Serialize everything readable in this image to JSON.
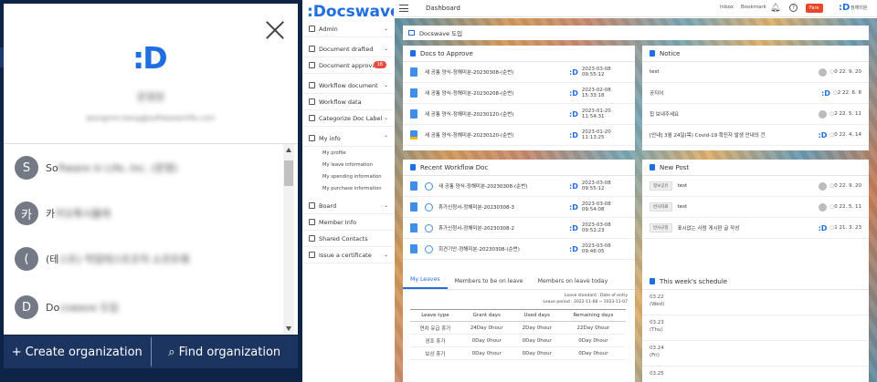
{
  "org_popup": {
    "logo": ":D",
    "user_name": "운영원",
    "user_email": "jeongmin.kang@softwareinlife.com",
    "orgs": [
      {
        "avatar": "S",
        "name": "So",
        "name_blur": "ftware in Life, Inc. (운영)"
      },
      {
        "avatar": "카",
        "name": "카",
        "name_blur": "카오톡시뮬레"
      },
      {
        "avatar": "(",
        "name": "(테",
        "name_blur": "스트) 작업테스트조직 소프트웨"
      },
      {
        "avatar": "D",
        "name": "Do",
        "name_blur": "cswave 도입"
      }
    ],
    "create_label": "Create organization",
    "find_label": "Find organization",
    "create_icon": "+",
    "find_icon": "⌕"
  },
  "brand": ":Docswave",
  "sidebar": {
    "items": [
      {
        "label": "Admin",
        "chev": "⌄"
      },
      {
        "label": "Document drafted",
        "chev": "⌄"
      },
      {
        "label": "Document approval",
        "badge": "18"
      },
      {
        "label": "Workflow document",
        "chev": "⌄"
      },
      {
        "label": "Workflow data"
      },
      {
        "label": "Categorize Doc Label",
        "chev": "⌄"
      },
      {
        "label": "My info",
        "chev": "⌃"
      }
    ],
    "sub": [
      "My profile",
      "My leave information",
      "My spending information",
      "My purchase information"
    ],
    "items2": [
      {
        "label": "Board",
        "chev": "⌄"
      },
      {
        "label": "Member Info"
      },
      {
        "label": "Shared Contacts"
      },
      {
        "label": "Issue a certificate",
        "chev": "⌄"
      }
    ]
  },
  "topbar": {
    "title": "Dashboard",
    "inbox": "Inbox",
    "bookmark": "Bookmark",
    "fare": "Fare",
    "user": "정해미분",
    "mini_logo": ":D"
  },
  "breadcrumb": "Docswave 도입",
  "docs_to_approve": {
    "title": "Docs to Approve",
    "rows": [
      {
        "title": "새 공통 양식-정해미분-20230308-(순번)",
        "date": "2023-03-08 09:55:12"
      },
      {
        "title": "새 공통 양식-정해미분-20230208-(순번)",
        "date": "2023-02-08 15:33:18"
      },
      {
        "title": "새 공통 양식-정해미분-20230120-(순번)",
        "date": "2023-01-20 11:54:31"
      },
      {
        "title": "새 공통 양식-정해미분-20230120-(순번)",
        "date": "2023-01-20 11:13:25"
      }
    ]
  },
  "notice": {
    "title": "Notice",
    "rows": [
      {
        "title": "test",
        "count": "0",
        "date": "22. 9. 20"
      },
      {
        "title": "공지어",
        "count": "2",
        "date": "22. 6. 8"
      },
      {
        "title": "칩 보내주세요",
        "count": "2",
        "date": "22. 5. 11"
      },
      {
        "title": "[안내] 3월 24일(목) Covid-19 확진자 발생 안내의 건",
        "count": "0",
        "date": "22. 4. 14"
      }
    ]
  },
  "recent_workflow": {
    "title": "Recent Workflow Doc",
    "rows": [
      {
        "title": "새 공통 양식-정해미분-20230308-(순번)",
        "date": "2023-03-08 09:55:12"
      },
      {
        "title": "휴가신청서-정해미분-20230308-3",
        "date": "2023-03-08 09:54:08"
      },
      {
        "title": "휴가신청서-정해미분-20230308-2",
        "date": "2023-03-08 09:52:23"
      },
      {
        "title": "회견기안-정해미분-20230308-(순번)",
        "date": "2023-03-08 09:46:05"
      }
    ]
  },
  "new_post": {
    "title": "New Post",
    "rows": [
      {
        "tag": "정보공유",
        "title": "test",
        "count": "0",
        "date": "22. 9. 20"
      },
      {
        "tag": "반사자료",
        "title": "test",
        "count": "0",
        "date": "22. 5. 11"
      },
      {
        "tag": "반사규정",
        "title": "표시없는 사람 게시판 글 작성",
        "count": "1",
        "date": "21. 3. 23"
      }
    ]
  },
  "leaves": {
    "tabs": [
      "My Leaves",
      "Members to be on leave",
      "Members on leave today"
    ],
    "meta1": "Leave standard : Date of entry",
    "meta2": "Leave period : 2022-11-08 ~ 2023-11-07",
    "headers": [
      "Leave type",
      "Grant days",
      "Used days",
      "Remaining days"
    ],
    "rows": [
      {
        "type": "연차 유급 휴가",
        "grant": "24Day 0hour",
        "used": "2Day 0hour",
        "remain": "22Day 0hour"
      },
      {
        "type": "경조 휴가",
        "grant": "0Day 0hour",
        "used": "0Day 0hour",
        "remain": "0Day 0hour"
      },
      {
        "type": "보상 휴가",
        "grant": "0Day 0hour",
        "used": "0Day 0hour",
        "remain": "0Day 0hour"
      }
    ]
  },
  "schedule": {
    "title": "This week's schedule",
    "days": [
      {
        "date": "03.22",
        "dow": "(Wed)"
      },
      {
        "date": "03.23",
        "dow": "(Thu)"
      },
      {
        "date": "03.24",
        "dow": "(Fri)"
      },
      {
        "date": "03.25",
        "dow": ""
      }
    ]
  }
}
